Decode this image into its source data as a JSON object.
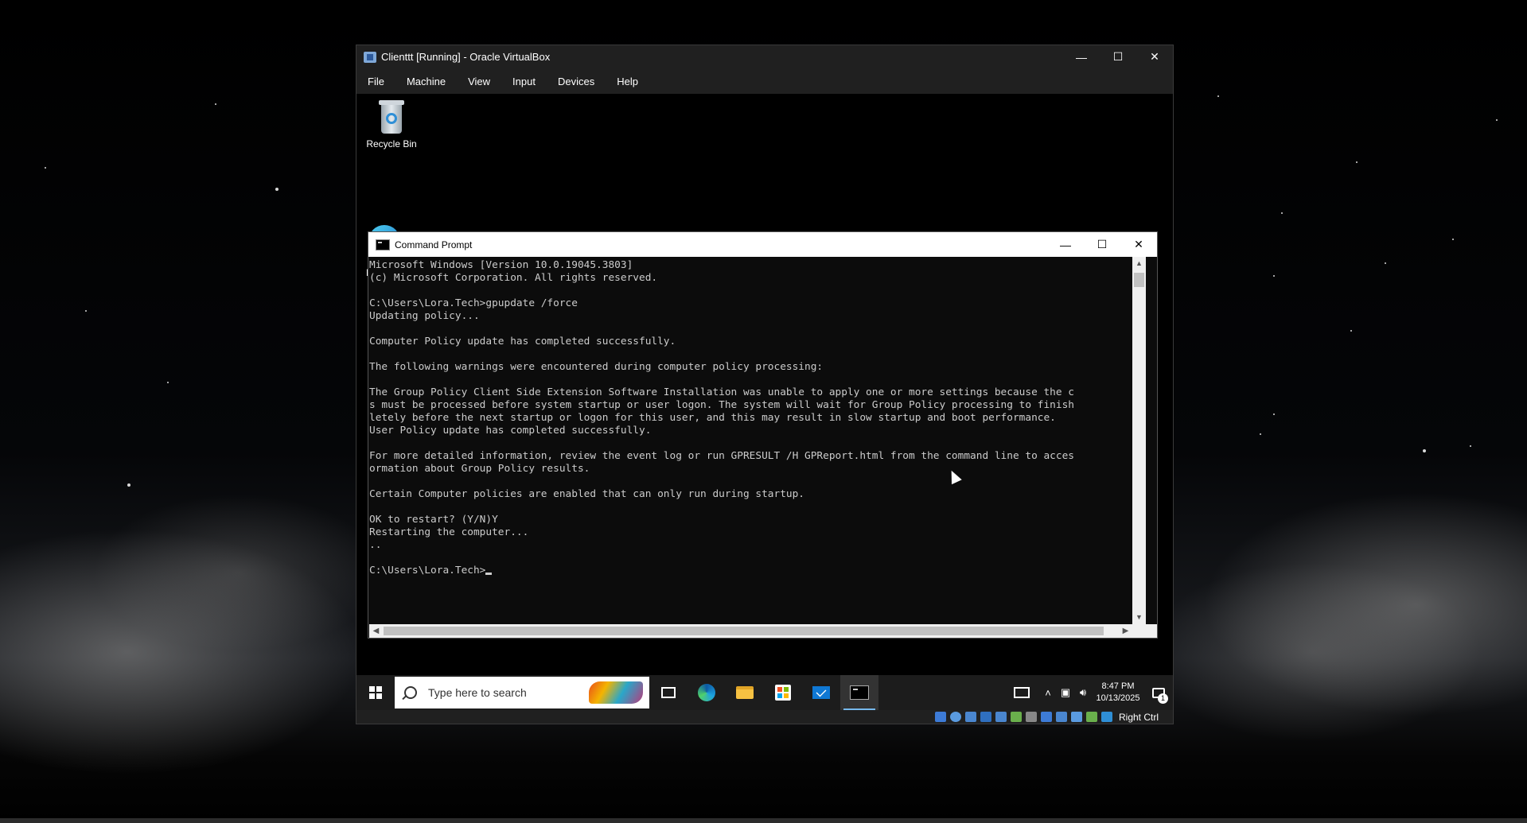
{
  "vbox": {
    "title": "Clienttt [Running] - Oracle VirtualBox",
    "menu": [
      "File",
      "Machine",
      "View",
      "Input",
      "Devices",
      "Help"
    ],
    "host_key": "Right Ctrl"
  },
  "desktop": {
    "recycle_bin_label": "Recycle Bin",
    "edge_partial_label": "Mi"
  },
  "cmd": {
    "title": "Command Prompt",
    "lines": [
      "Microsoft Windows [Version 10.0.19045.3803]",
      "(c) Microsoft Corporation. All rights reserved.",
      "",
      "C:\\Users\\Lora.Tech>gpupdate /force",
      "Updating policy...",
      "",
      "Computer Policy update has completed successfully.",
      "",
      "The following warnings were encountered during computer policy processing:",
      "",
      "The Group Policy Client Side Extension Software Installation was unable to apply one or more settings because the c",
      "s must be processed before system startup or user logon. The system will wait for Group Policy processing to finish",
      "letely before the next startup or logon for this user, and this may result in slow startup and boot performance.",
      "User Policy update has completed successfully.",
      "",
      "For more detailed information, review the event log or run GPRESULT /H GPReport.html from the command line to acces",
      "ormation about Group Policy results.",
      "",
      "Certain Computer policies are enabled that can only run during startup.",
      "",
      "OK to restart? (Y/N)Y",
      "Restarting the computer...",
      "..",
      ""
    ],
    "prompt": "C:\\Users\\Lora.Tech>"
  },
  "taskbar": {
    "search_placeholder": "Type here to search",
    "apps": [
      "task-view",
      "edge",
      "file-explorer",
      "microsoft-store",
      "mail",
      "command-prompt"
    ],
    "time": "8:47 PM",
    "date": "10/13/2025",
    "notification_count": "1"
  },
  "colors": {
    "console_bg": "#0c0c0c",
    "console_text": "#cccccc",
    "taskbar_bg": "#1c1c1c",
    "vbox_chrome": "#202020"
  }
}
